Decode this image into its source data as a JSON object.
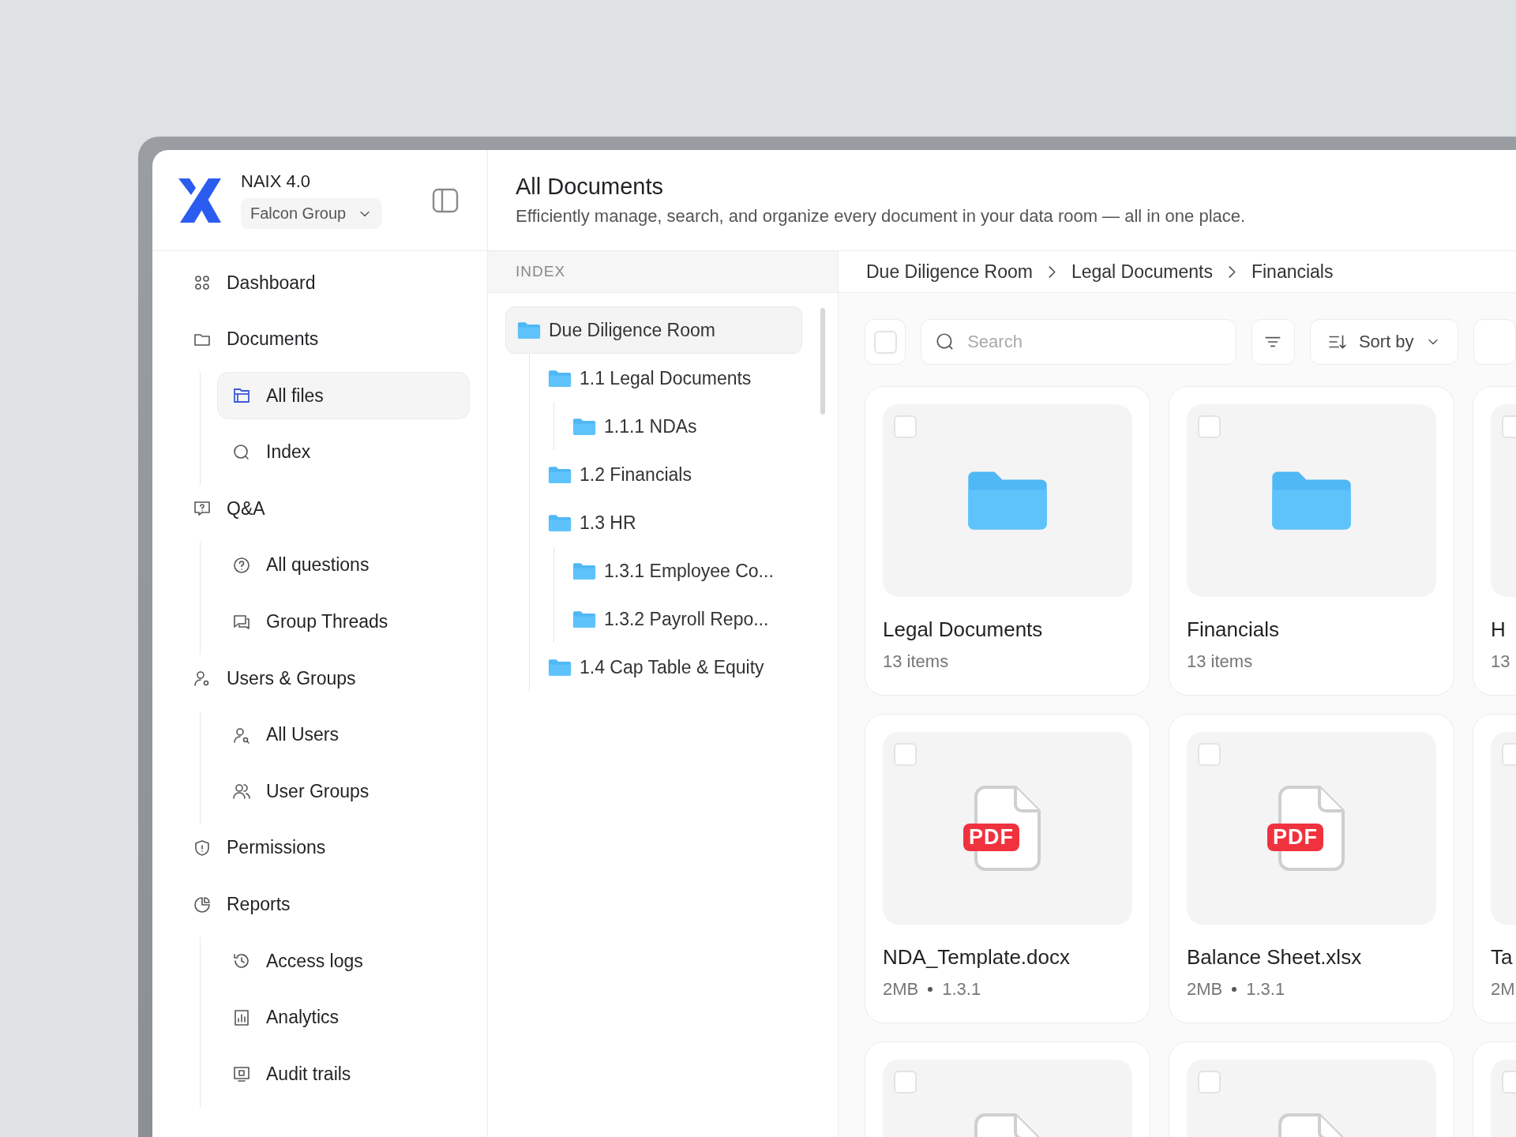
{
  "app": {
    "name": "NAIX 4.0",
    "workspace": "Falcon Group"
  },
  "sidebar": {
    "items": [
      {
        "label": "Dashboard",
        "selected": false
      },
      {
        "label": "Documents",
        "selected": false,
        "children": [
          {
            "label": "All files",
            "selected": true
          },
          {
            "label": "Index",
            "selected": false
          }
        ]
      },
      {
        "label": "Q&A",
        "selected": false,
        "children": [
          {
            "label": "All questions",
            "selected": false
          },
          {
            "label": "Group Threads",
            "selected": false
          }
        ]
      },
      {
        "label": "Users & Groups",
        "selected": false,
        "children": [
          {
            "label": "All Users",
            "selected": false
          },
          {
            "label": "User Groups",
            "selected": false
          }
        ]
      },
      {
        "label": "Permissions",
        "selected": false
      },
      {
        "label": "Reports",
        "selected": false,
        "children": [
          {
            "label": "Access logs",
            "selected": false
          },
          {
            "label": "Analytics",
            "selected": false
          },
          {
            "label": "Audit trails",
            "selected": false
          }
        ]
      }
    ]
  },
  "header": {
    "title": "All Documents",
    "subtitle": "Efficiently manage, search, and organize every document in your data room — all in one place."
  },
  "index": {
    "heading": "INDEX",
    "tree": [
      {
        "label": "Due Diligence Room",
        "selected": true,
        "children": [
          {
            "label": "1.1 Legal Documents",
            "selected": false,
            "children": [
              {
                "label": "1.1.1 NDAs",
                "selected": false
              }
            ]
          },
          {
            "label": "1.2 Financials",
            "selected": false
          },
          {
            "label": "1.3 HR",
            "selected": false,
            "children": [
              {
                "label": "1.3.1 Employee Co...",
                "selected": false
              },
              {
                "label": "1.3.2 Payroll Repo...",
                "selected": false
              }
            ]
          },
          {
            "label": "1.4 Cap Table & Equity",
            "selected": false
          }
        ]
      }
    ]
  },
  "breadcrumb": [
    "Due Diligence Room",
    "Legal Documents",
    "Financials"
  ],
  "toolbar": {
    "select_all_checked": false,
    "search": {
      "placeholder": "Search"
    },
    "sort": {
      "label": "Sort by"
    }
  },
  "cards": [
    {
      "kind": "folder",
      "name": "Legal Documents",
      "meta": [
        "13 items"
      ],
      "checked": false
    },
    {
      "kind": "folder",
      "name": "Financials",
      "meta": [
        "13 items"
      ],
      "checked": false
    },
    {
      "kind": "cut",
      "name": "H",
      "meta": [
        "13"
      ],
      "checked": false
    },
    {
      "kind": "pdf",
      "badge": "PDF",
      "name": "NDA_Template.docx",
      "meta": [
        "2MB",
        "1.3.1"
      ],
      "checked": false
    },
    {
      "kind": "pdf",
      "badge": "PDF",
      "name": "Balance Sheet.xlsx",
      "meta": [
        "2MB",
        "1.3.1"
      ],
      "checked": false
    },
    {
      "kind": "cut",
      "name": "Ta",
      "meta": [
        "2M"
      ],
      "checked": false
    },
    {
      "kind": "file",
      "checked": false
    },
    {
      "kind": "file",
      "checked": false
    },
    {
      "kind": "cut",
      "checked": false
    }
  ]
}
